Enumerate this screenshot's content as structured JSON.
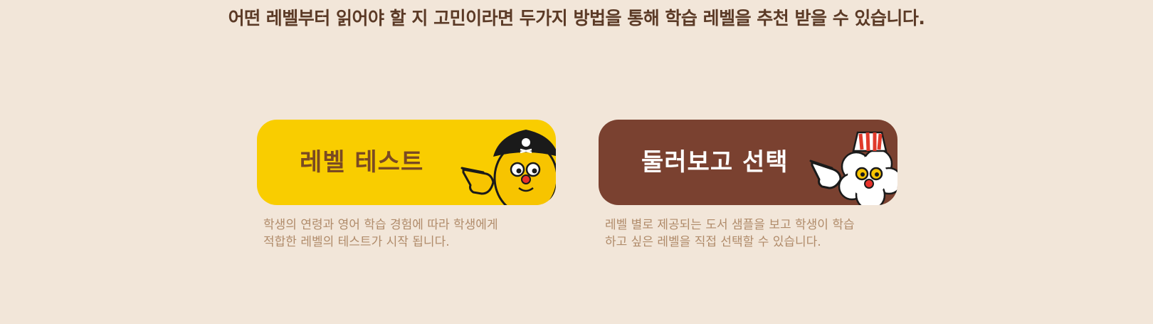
{
  "headline": "어떤 레벨부터 읽어야 할 지 고민이라면 두가지 방법을 통해 학습 레벨을 추천 받을 수 있습니다.",
  "options": [
    {
      "label": "레벨 테스트",
      "color": "#f9cd00",
      "mascot": "pirate-hat-mascot-icon",
      "description": [
        "학생의 연령과 영어 학습 경험에 따라 학생에게",
        "적합한 레벨의 테스트가 시작 됩니다."
      ]
    },
    {
      "label": "둘러보고 선택",
      "color": "#7a4130",
      "mascot": "popcorn-mascot-icon",
      "description": [
        "레벨 별로 제공되는 도서 샘플을 보고 학생이 학습",
        "하고 싶은 레벨을 직접 선택할 수 있습니다."
      ]
    }
  ]
}
